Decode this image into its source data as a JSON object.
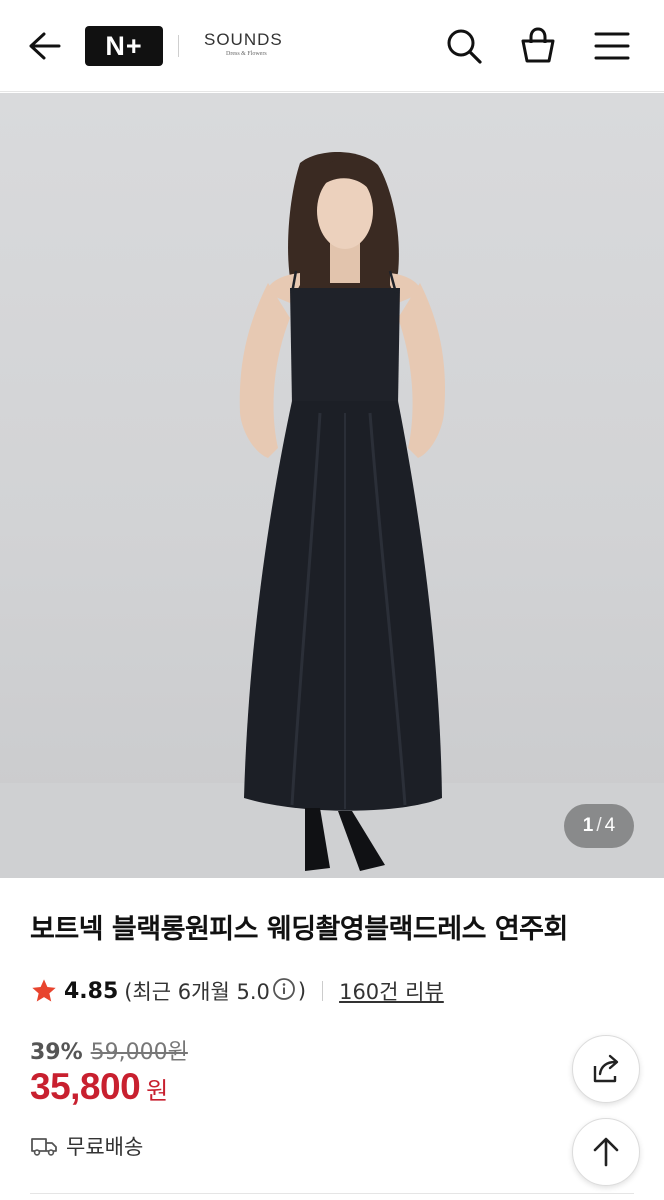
{
  "header": {
    "back_icon": "arrow-left-icon",
    "logo_nplus": "N+",
    "brand_logo_main": "SOUNDS",
    "brand_logo_sub": "Dress & Flowers",
    "search_icon": "search-icon",
    "cart_icon": "shopping-bag-icon",
    "menu_icon": "hamburger-menu-icon"
  },
  "gallery": {
    "current": "1",
    "separator": "/",
    "total": "4"
  },
  "product": {
    "title": "보트넥 블랙롱원피스 웨딩촬영블랙드레스 연주회",
    "rating_score": "4.85",
    "rating_recent_open": "(최근 6개월 5.0",
    "rating_recent_close": ")",
    "review_count_label": "160건 리뷰",
    "discount_rate": "39%",
    "original_price": "59,000원",
    "sale_price": "35,800",
    "currency_unit": "원",
    "shipping_label": "무료배송"
  },
  "colors": {
    "accent_red": "#c8202f",
    "star": "#e8442e"
  }
}
